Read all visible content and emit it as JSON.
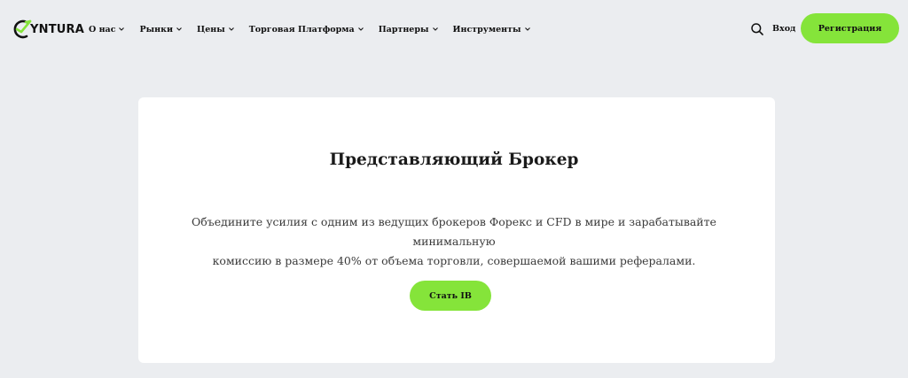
{
  "brand": {
    "logo_text": "YNTURA",
    "accent": "#85e43a"
  },
  "nav": {
    "items": [
      {
        "label": "О нас"
      },
      {
        "label": "Рынки"
      },
      {
        "label": "Цены"
      },
      {
        "label": "Торговая Платформа"
      },
      {
        "label": "Партнеры"
      },
      {
        "label": "Инструменты"
      }
    ]
  },
  "header": {
    "search_icon": "search-icon",
    "login_label": "Вход",
    "register_label": "Регистрация"
  },
  "main": {
    "title": "Представляющий Брокер",
    "description_line1": "Объедините усилия с одним из ведущих брокеров Форекс и CFD в мире и зарабатывайте минимальную",
    "description_line2": "комиссию в размере 40% от объема торговли, совершаемой вашими рефералами.",
    "cta_label": "Стать IB"
  }
}
